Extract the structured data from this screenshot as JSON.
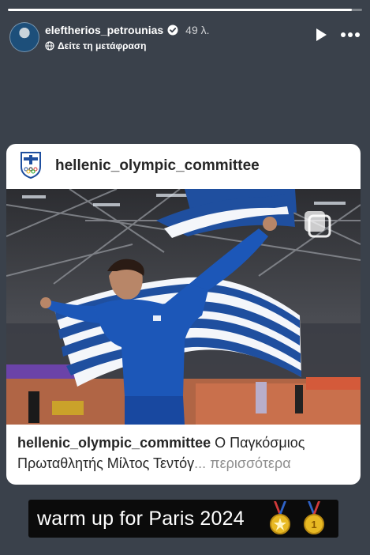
{
  "story": {
    "progress": 0.97,
    "username": "eleftherios_petrounias",
    "time": "49 λ.",
    "translate_label": "Δείτε τη μετάφραση"
  },
  "post": {
    "account": "hellenic_olympic_committee",
    "caption_user": "hellenic_olympic_committee",
    "caption_text": " Ο Παγκόσμιος Πρωταθλητής Μίλτος Τεντόγ",
    "caption_more": "... περισσότερα"
  },
  "sticker": {
    "text": "warm up for Paris 2024"
  },
  "colors": {
    "background": "#3a414b",
    "flag_blue": "#1f4f9f",
    "medal_gold": "#e8b923"
  },
  "icons": [
    "verified-icon",
    "globe-icon",
    "play-icon",
    "more-icon",
    "carousel-icon",
    "medal-icon"
  ]
}
